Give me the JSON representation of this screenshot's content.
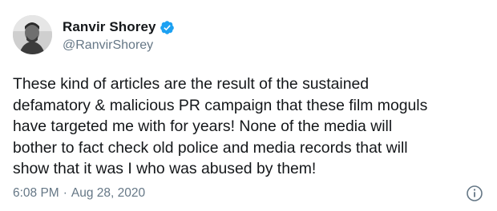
{
  "tweet": {
    "author": {
      "display_name": "Ranvir Shorey",
      "handle": "@RanvirShorey",
      "verified": true
    },
    "text_lines": [
      "These kind of articles are the result of the sustained",
      "defamatory & malicious PR campaign that these film moguls",
      "have targeted me with for years! None of the media will",
      "bother to fact check old police and media records that will",
      "show that it was I who was abused by them!"
    ],
    "time": "6:08 PM",
    "separator": "·",
    "date": "Aug 28, 2020"
  },
  "icons": {
    "verified": "verified-badge-icon",
    "info": "info-icon"
  },
  "colors": {
    "text": "#14171a",
    "secondary": "#657786",
    "verified_blue": "#1da1f2"
  }
}
